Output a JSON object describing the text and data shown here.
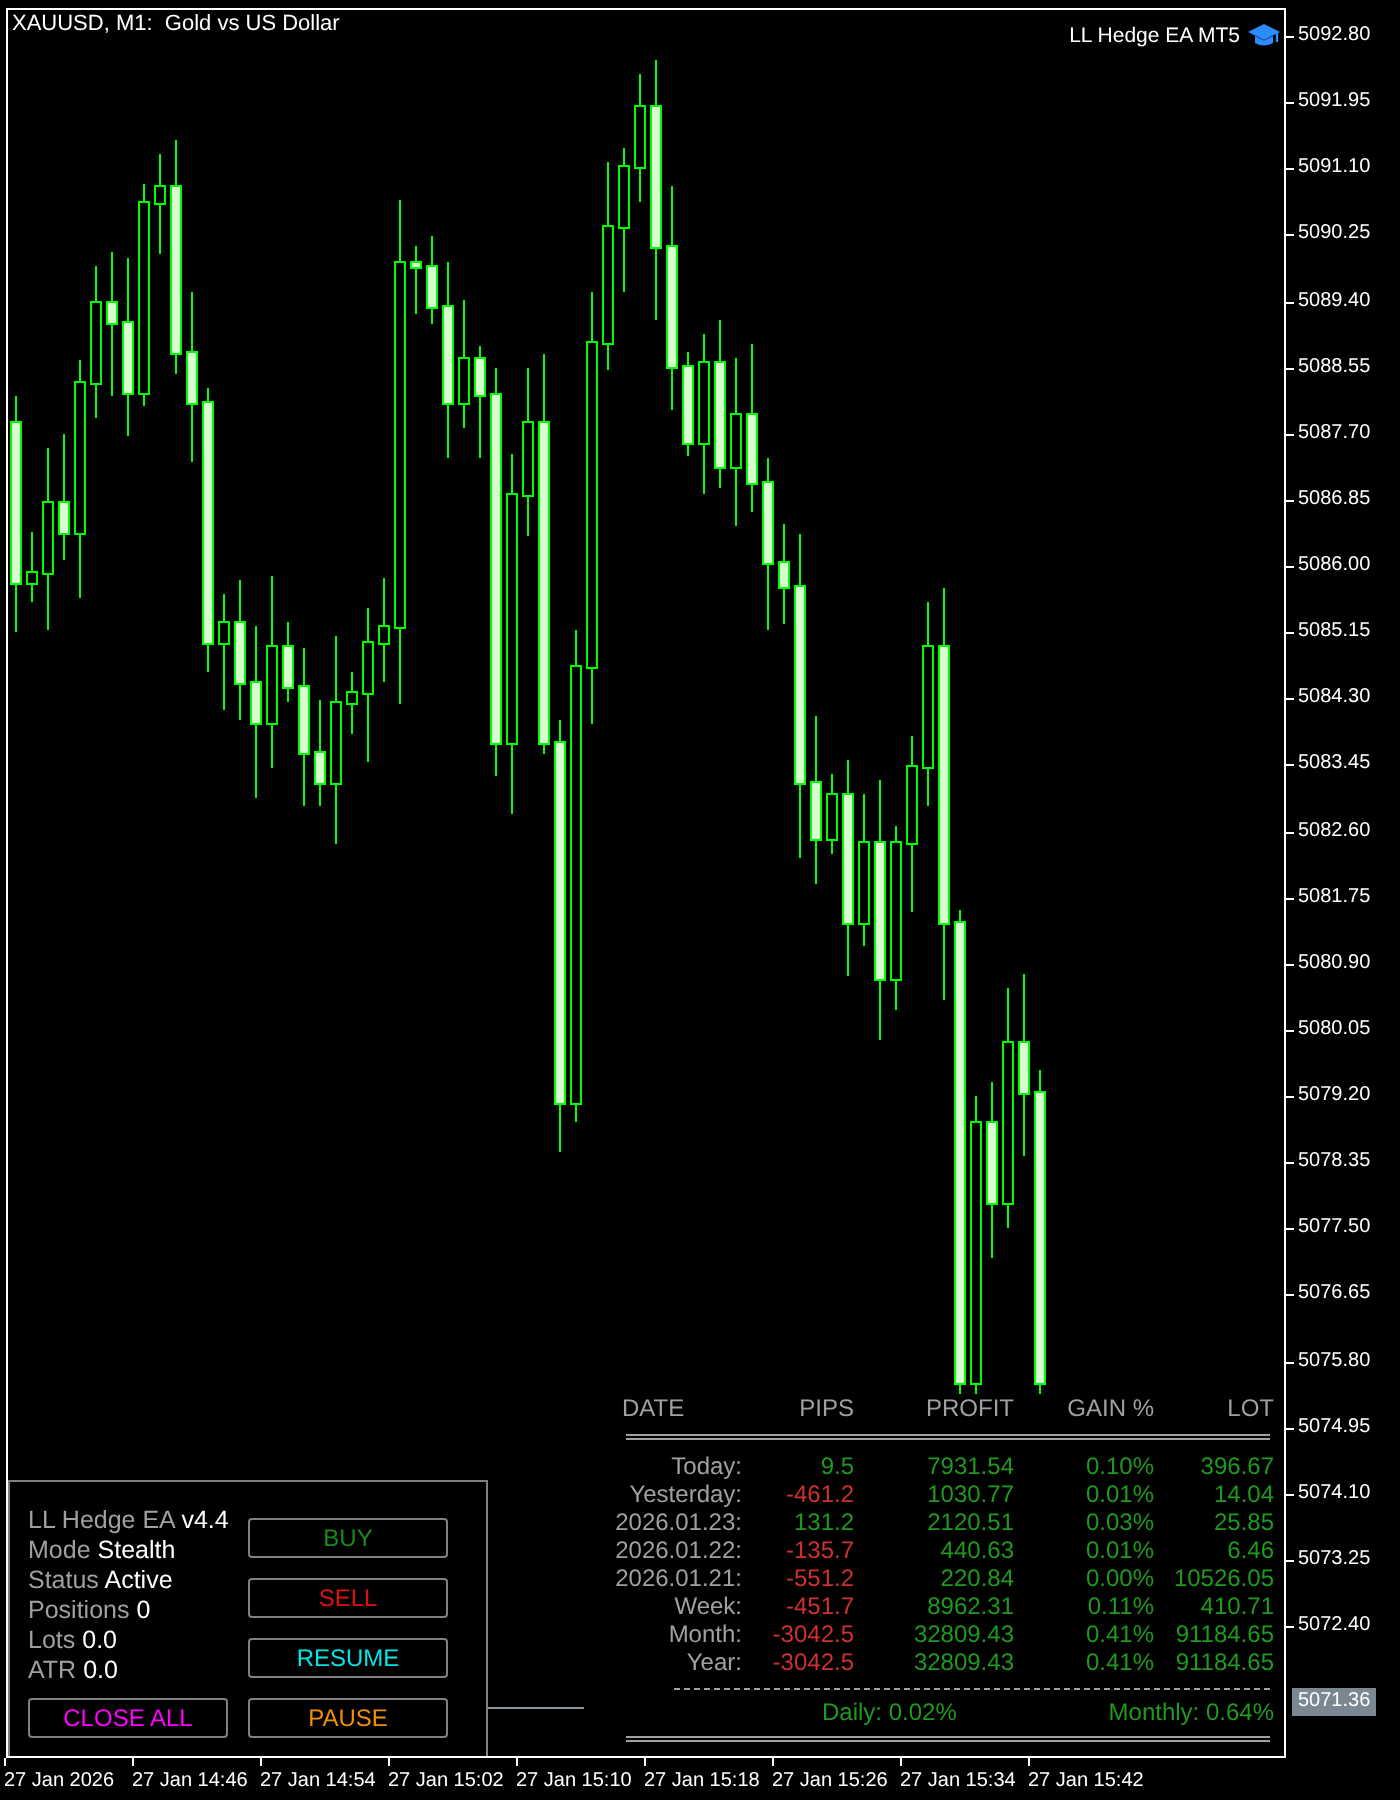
{
  "window": {
    "symbol_title": "XAUUSD, M1:  Gold vs US Dollar",
    "ea_label": "LL Hedge EA MT5"
  },
  "price_axis": [
    "5092.80",
    "5091.95",
    "5091.10",
    "5090.25",
    "5089.40",
    "5088.55",
    "5087.70",
    "5086.85",
    "5086.00",
    "5085.15",
    "5084.30",
    "5083.45",
    "5082.60",
    "5081.75",
    "5080.90",
    "5080.05",
    "5079.20",
    "5078.35",
    "5077.50",
    "5076.65",
    "5075.80",
    "5074.95",
    "5074.10",
    "5073.25",
    "5072.40"
  ],
  "current_price": "5071.36",
  "time_axis": [
    "27 Jan 2026",
    "27 Jan 14:46",
    "27 Jan 14:54",
    "27 Jan 15:02",
    "27 Jan 15:10",
    "27 Jan 15:18",
    "27 Jan 15:26",
    "27 Jan 15:34",
    "27 Jan 15:42"
  ],
  "ea_panel": {
    "info": [
      {
        "label": "LL Hedge EA",
        "value": "v4.4"
      },
      {
        "label": "Mode",
        "value": "Stealth"
      },
      {
        "label": "Status",
        "value": "Active"
      },
      {
        "label": "Positions",
        "value": "0"
      },
      {
        "label": "Lots",
        "value": "0.0"
      },
      {
        "label": "ATR",
        "value": "0.0"
      }
    ],
    "buttons": [
      {
        "label": "BUY",
        "color": "#1a8a1a"
      },
      {
        "label": "SELL",
        "color": "#e01010"
      },
      {
        "label": "RESUME",
        "color": "#00e5e5"
      },
      {
        "label": "CLOSE ALL",
        "color": "#ff00ff"
      },
      {
        "label": "PAUSE",
        "color": "#f09000"
      }
    ]
  },
  "stats": {
    "columns": [
      "DATE",
      "PIPS",
      "PROFIT",
      "GAIN %",
      "LOT"
    ],
    "rows": [
      {
        "date": "Today:",
        "pips": {
          "text": "9.5",
          "color": "#1f9a1f"
        },
        "profit": "7931.54",
        "gain": "0.10%",
        "lot": "396.67"
      },
      {
        "date": "Yesterday:",
        "pips": {
          "text": "-461.2",
          "color": "#d03030"
        },
        "profit": "1030.77",
        "gain": "0.01%",
        "lot": "14.04"
      },
      {
        "date": "2026.01.23:",
        "pips": {
          "text": "131.2",
          "color": "#1f9a1f"
        },
        "profit": "2120.51",
        "gain": "0.03%",
        "lot": "25.85"
      },
      {
        "date": "2026.01.22:",
        "pips": {
          "text": "-135.7",
          "color": "#d03030"
        },
        "profit": "440.63",
        "gain": "0.01%",
        "lot": "6.46"
      },
      {
        "date": "2026.01.21:",
        "pips": {
          "text": "-551.2",
          "color": "#d03030"
        },
        "profit": "220.84",
        "gain": "0.00%",
        "lot": "10526.05"
      },
      {
        "date": "Week:",
        "pips": {
          "text": "-451.7",
          "color": "#d03030"
        },
        "profit": "8962.31",
        "gain": "0.11%",
        "lot": "410.71"
      },
      {
        "date": "Month:",
        "pips": {
          "text": "-3042.5",
          "color": "#d03030"
        },
        "profit": "32809.43",
        "gain": "0.41%",
        "lot": "91184.65"
      },
      {
        "date": "Year:",
        "pips": {
          "text": "-3042.5",
          "color": "#d03030"
        },
        "profit": "32809.43",
        "gain": "0.41%",
        "lot": "91184.65"
      }
    ],
    "daily": "Daily: 0.02%",
    "monthly": "Monthly: 0.64%"
  }
}
